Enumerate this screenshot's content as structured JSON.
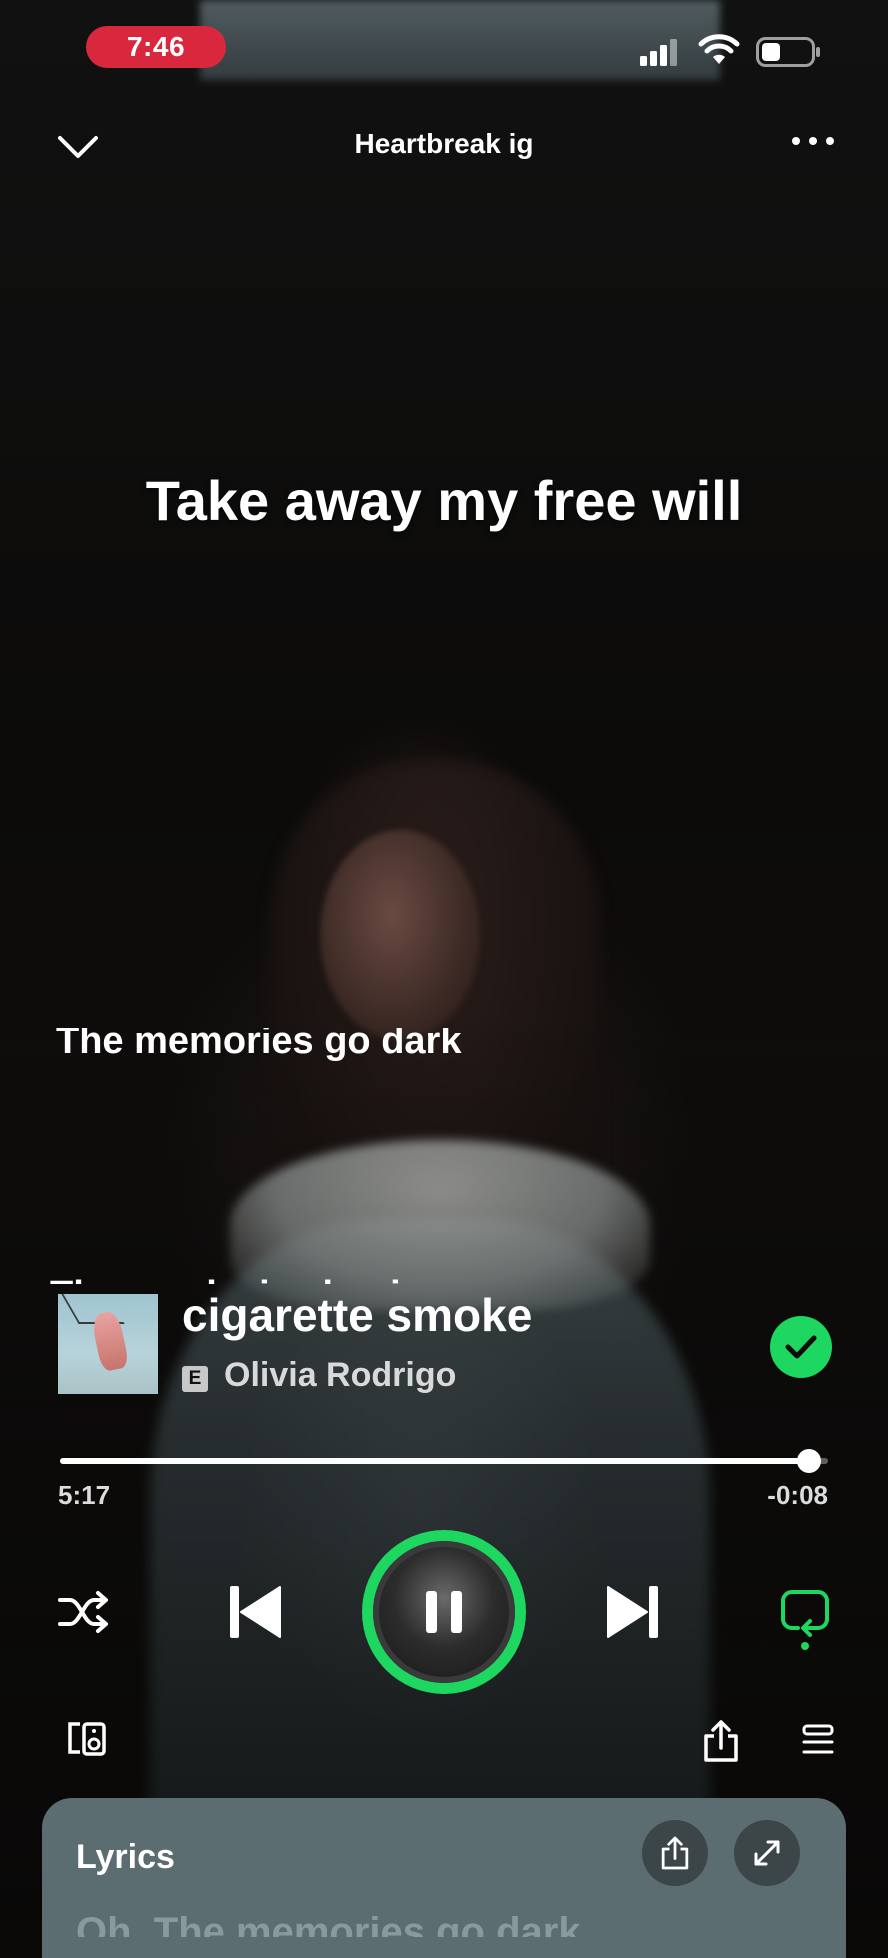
{
  "status_bar": {
    "time": "7:46"
  },
  "header": {
    "title": "Heartbreak ig"
  },
  "lyrics": {
    "current_line": "Take away my free will",
    "next_line": "The memories go dark",
    "cut_line": "The smoke is clearing"
  },
  "track": {
    "title": "cigarette smoke",
    "explicit_badge": "E",
    "artist": "Olivia Rodrigo",
    "saved": true
  },
  "progress": {
    "elapsed": "5:17",
    "remaining": "-0:08",
    "fraction": 0.975
  },
  "controls": {
    "shuffle": false,
    "repeat": true,
    "state": "playing"
  },
  "lyrics_card": {
    "title": "Lyrics",
    "preview": "Oh, The memories go dark"
  },
  "colors": {
    "accent": "#1ed760",
    "time_pill": "#d9283e",
    "card_bg": "#5c6d72"
  },
  "icons": [
    "chevron-down-icon",
    "more-icon",
    "shuffle-icon",
    "previous-icon",
    "pause-icon",
    "next-icon",
    "repeat-icon",
    "devices-icon",
    "share-icon",
    "queue-icon",
    "expand-icon",
    "checkmark-icon"
  ]
}
